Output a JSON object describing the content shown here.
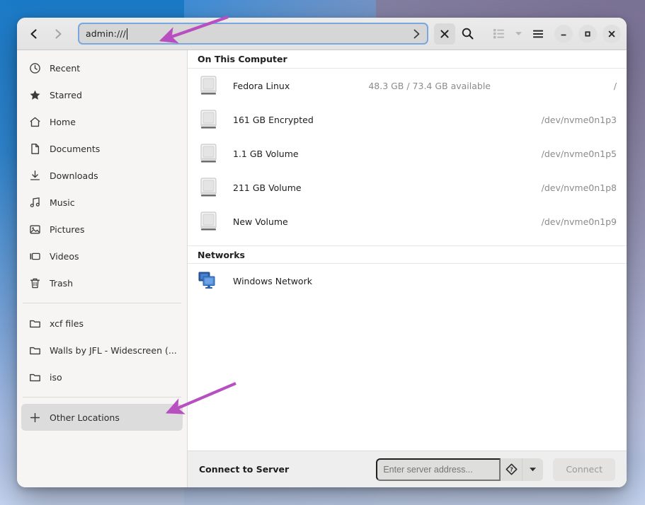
{
  "window": {
    "headerbar": {
      "back_label": "Back",
      "forward_label": "Forward",
      "path_value": "admin:///",
      "path_go_label": "Go",
      "clear_label": "Clear",
      "search_label": "Search",
      "view_list_label": "List view",
      "view_options_label": "View options",
      "menu_label": "Main menu",
      "minimize_label": "Minimize",
      "maximize_label": "Maximize",
      "close_label": "Close"
    }
  },
  "sidebar": {
    "places": [
      {
        "label": "Recent",
        "icon": "clock-icon",
        "selected": false
      },
      {
        "label": "Starred",
        "icon": "star-icon",
        "selected": false
      },
      {
        "label": "Home",
        "icon": "home-icon",
        "selected": false
      },
      {
        "label": "Documents",
        "icon": "document-icon",
        "selected": false
      },
      {
        "label": "Downloads",
        "icon": "download-icon",
        "selected": false
      },
      {
        "label": "Music",
        "icon": "music-icon",
        "selected": false
      },
      {
        "label": "Pictures",
        "icon": "picture-icon",
        "selected": false
      },
      {
        "label": "Videos",
        "icon": "video-icon",
        "selected": false
      },
      {
        "label": "Trash",
        "icon": "trash-icon",
        "selected": false
      }
    ],
    "bookmarks": [
      {
        "label": "xcf files",
        "icon": "folder-icon",
        "selected": false
      },
      {
        "label": "Walls by JFL - Widescreen (...",
        "icon": "folder-icon",
        "selected": false
      },
      {
        "label": "iso",
        "icon": "folder-icon",
        "selected": false
      }
    ],
    "other_locations": {
      "label": "Other Locations",
      "icon": "plus-icon",
      "selected": true
    }
  },
  "main": {
    "groups": [
      {
        "title": "On This Computer",
        "rows": [
          {
            "name": "Fedora Linux",
            "free": "48.3 GB / 73.4 GB available",
            "mount": "/",
            "icon": "drive-harddisk-icon"
          },
          {
            "name": "161 GB Encrypted",
            "free": "",
            "mount": "/dev/nvme0n1p3",
            "icon": "drive-harddisk-icon"
          },
          {
            "name": "1.1 GB Volume",
            "free": "",
            "mount": "/dev/nvme0n1p5",
            "icon": "drive-harddisk-icon"
          },
          {
            "name": "211 GB Volume",
            "free": "",
            "mount": "/dev/nvme0n1p8",
            "icon": "drive-harddisk-icon"
          },
          {
            "name": "New Volume",
            "free": "",
            "mount": "/dev/nvme0n1p9",
            "icon": "drive-harddisk-icon"
          }
        ]
      },
      {
        "title": "Networks",
        "rows": [
          {
            "name": "Windows Network",
            "free": "",
            "mount": "",
            "icon": "network-workgroup-icon"
          }
        ]
      }
    ]
  },
  "connect_to_server": {
    "label": "Connect to Server",
    "input_value": "",
    "input_placeholder": "Enter server address...",
    "help_label": "Help",
    "dropdown_label": "Recent servers",
    "button_label": "Connect"
  },
  "annotations": {
    "arrow_color": "#b84fc0",
    "arrow_path_bar_target": "path-entry",
    "arrow_other_locations_target": "sidebar-item-other-locations"
  },
  "colors": {
    "accent": "#7aa7dd",
    "selection": "#dcdcdc",
    "sidebar_bg": "#f6f5f4",
    "header_bg": "#e8e8e8",
    "annotation": "#b84fc0"
  }
}
